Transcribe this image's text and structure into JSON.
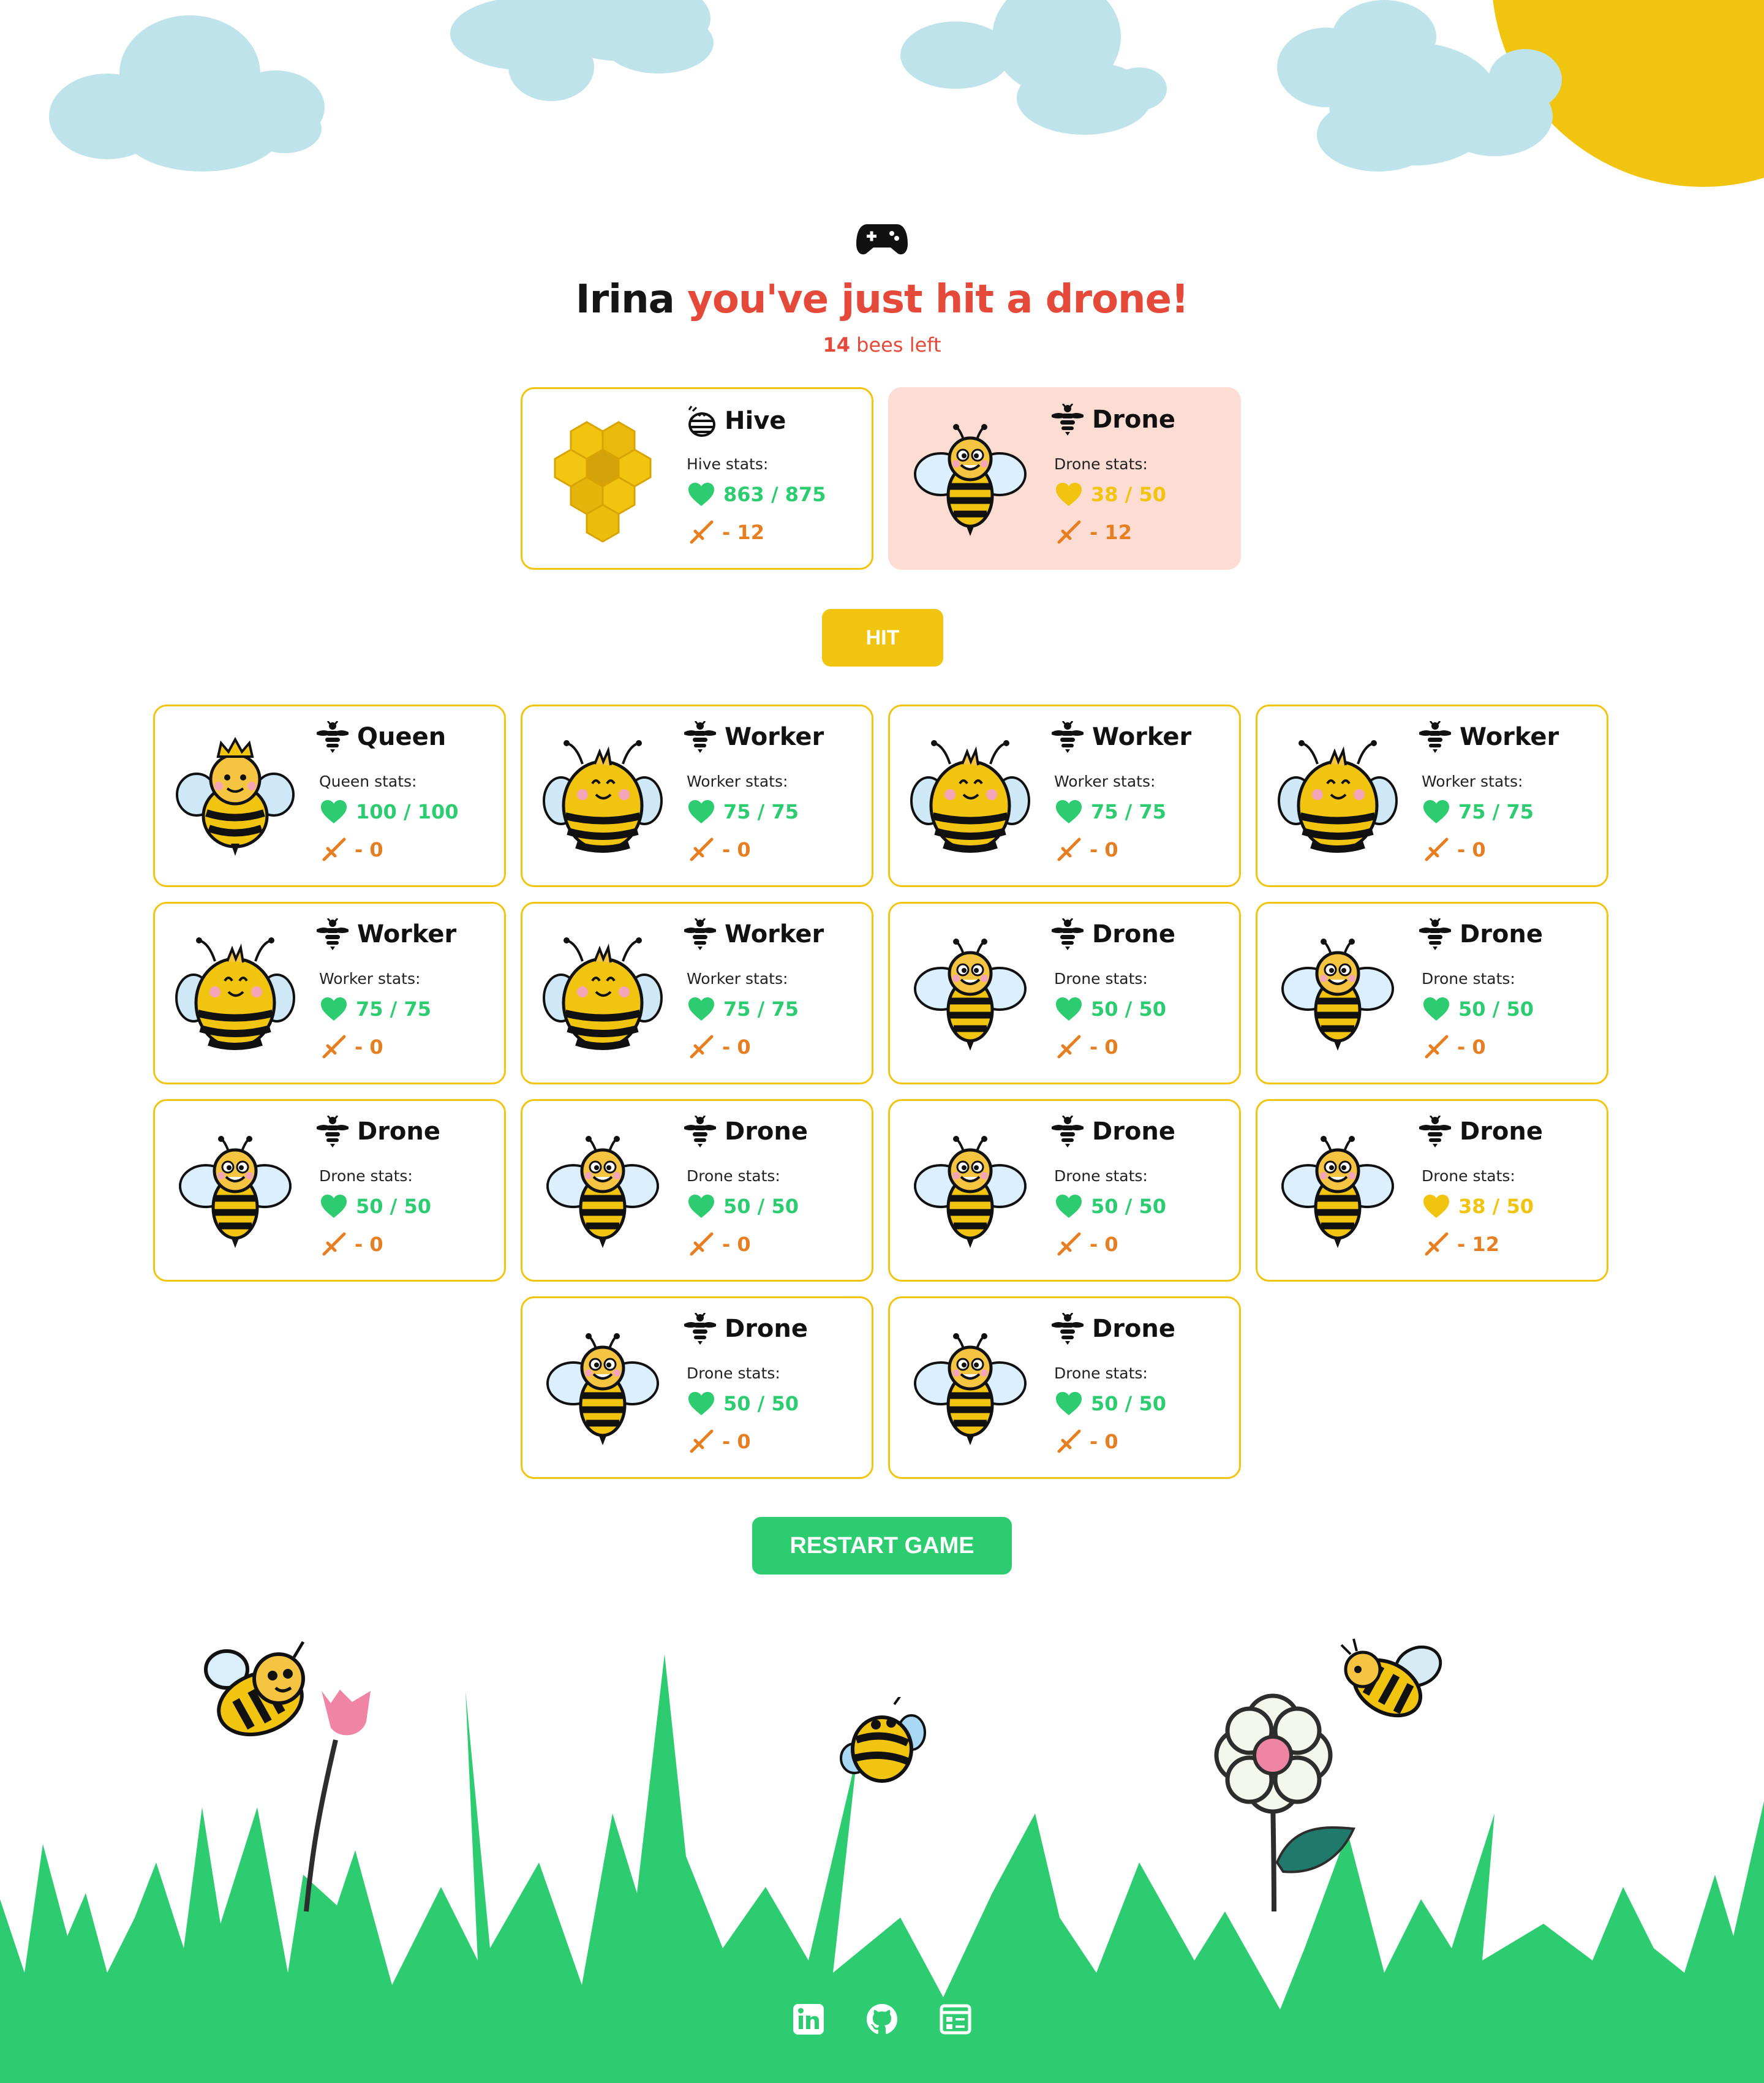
{
  "player_name": "Irina",
  "message": "you've just hit a drone!",
  "bees_left": {
    "count": "14",
    "label": "bees left"
  },
  "targets": [
    {
      "title": "Hive",
      "stats_label": "Hive stats:",
      "hp": "863 / 875",
      "damage": "- 12",
      "kind": "hive",
      "hit": false,
      "hp_low": false
    },
    {
      "title": "Drone",
      "stats_label": "Drone stats:",
      "hp": "38 / 50",
      "damage": "- 12",
      "kind": "drone",
      "hit": true,
      "hp_low": true
    }
  ],
  "hit_button": "HIT",
  "bees": [
    {
      "title": "Queen",
      "stats_label": "Queen stats:",
      "hp": "100 / 100",
      "damage": "- 0",
      "kind": "queen",
      "hp_low": false
    },
    {
      "title": "Worker",
      "stats_label": "Worker stats:",
      "hp": "75 / 75",
      "damage": "- 0",
      "kind": "worker",
      "hp_low": false
    },
    {
      "title": "Worker",
      "stats_label": "Worker stats:",
      "hp": "75 / 75",
      "damage": "- 0",
      "kind": "worker",
      "hp_low": false
    },
    {
      "title": "Worker",
      "stats_label": "Worker stats:",
      "hp": "75 / 75",
      "damage": "- 0",
      "kind": "worker",
      "hp_low": false
    },
    {
      "title": "Worker",
      "stats_label": "Worker stats:",
      "hp": "75 / 75",
      "damage": "- 0",
      "kind": "worker",
      "hp_low": false
    },
    {
      "title": "Worker",
      "stats_label": "Worker stats:",
      "hp": "75 / 75",
      "damage": "- 0",
      "kind": "worker",
      "hp_low": false
    },
    {
      "title": "Drone",
      "stats_label": "Drone stats:",
      "hp": "50 / 50",
      "damage": "- 0",
      "kind": "drone",
      "hp_low": false
    },
    {
      "title": "Drone",
      "stats_label": "Drone stats:",
      "hp": "50 / 50",
      "damage": "- 0",
      "kind": "drone",
      "hp_low": false
    },
    {
      "title": "Drone",
      "stats_label": "Drone stats:",
      "hp": "50 / 50",
      "damage": "- 0",
      "kind": "drone",
      "hp_low": false
    },
    {
      "title": "Drone",
      "stats_label": "Drone stats:",
      "hp": "50 / 50",
      "damage": "- 0",
      "kind": "drone",
      "hp_low": false
    },
    {
      "title": "Drone",
      "stats_label": "Drone stats:",
      "hp": "50 / 50",
      "damage": "- 0",
      "kind": "drone",
      "hp_low": false
    },
    {
      "title": "Drone",
      "stats_label": "Drone stats:",
      "hp": "38 / 50",
      "damage": "- 12",
      "kind": "drone",
      "hp_low": true
    },
    {
      "title": "Drone",
      "stats_label": "Drone stats:",
      "hp": "50 / 50",
      "damage": "- 0",
      "kind": "drone",
      "hp_low": false
    },
    {
      "title": "Drone",
      "stats_label": "Drone stats:",
      "hp": "50 / 50",
      "damage": "- 0",
      "kind": "drone",
      "hp_low": false
    }
  ],
  "restart_button": "RESTART GAME",
  "footer_links": [
    {
      "icon": "linkedin-icon"
    },
    {
      "icon": "github-icon"
    },
    {
      "icon": "portfolio-icon"
    }
  ],
  "colors": {
    "yellow": "#f1c40f",
    "green": "#2ecc71",
    "red": "#e5493a",
    "orange": "#e67e22",
    "hit_bg": "#fddcd3",
    "cloud": "#bfe3ea"
  }
}
